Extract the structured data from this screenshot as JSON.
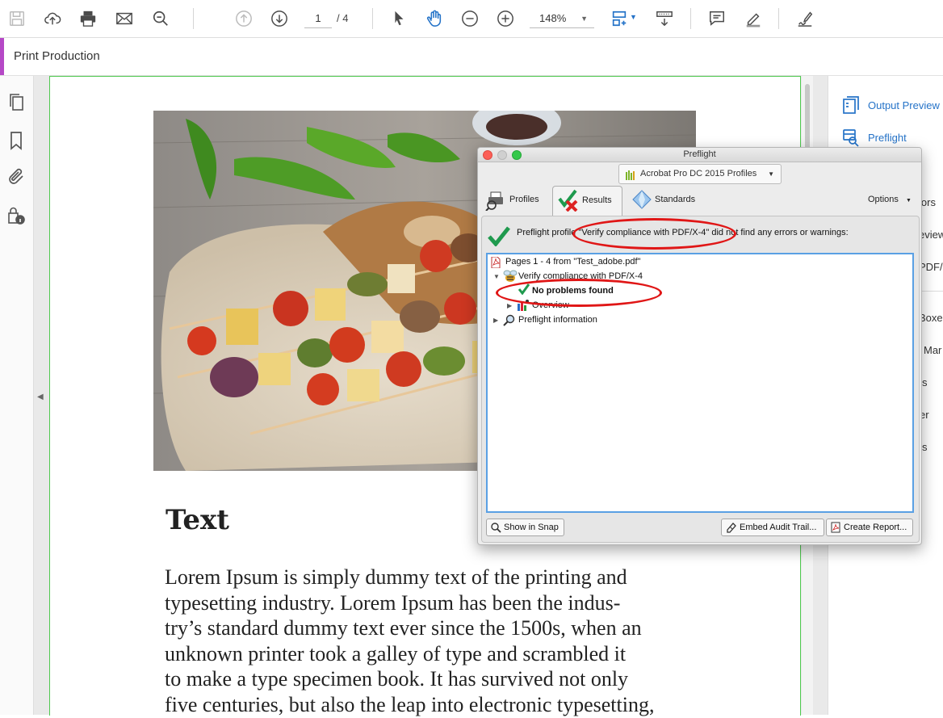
{
  "toolbar": {
    "page_current": "1",
    "page_total": "/ 4",
    "zoom": "148%",
    "icons": [
      "save-icon",
      "upload-icon",
      "print-icon",
      "email-icon",
      "search-icon",
      "page-up-icon",
      "page-down-icon",
      "select-cursor-icon",
      "hand-icon",
      "zoom-out-icon",
      "zoom-in-icon",
      "fit-page-icon",
      "scroll-mode-icon",
      "comment-icon",
      "highlight-icon",
      "sign-icon"
    ]
  },
  "tool_header": {
    "title": "Print Production",
    "accent_color": "#b548c6"
  },
  "left_nav": {
    "icons": [
      "pages-icon",
      "bookmark-icon",
      "attachment-icon",
      "security-icon"
    ]
  },
  "document": {
    "heading": "Text",
    "body_lines": [
      "Lorem Ipsum is simply dummy text of the printing and",
      "typesetting industry. Lorem Ipsum has been the indus-",
      "try’s standard dummy text ever since the 1500s, when an",
      "unknown printer took a galley of type and scrambled it",
      "to make a type specimen book. It has survived not only",
      "five centuries, but also the leap into electronic typesetting,"
    ]
  },
  "right_panel": {
    "links": [
      "Output Preview",
      "Preflight"
    ],
    "clipped_items": [
      "lors",
      "eview",
      "PDF/X",
      "Boxes",
      "Mar",
      "s",
      "er",
      "s"
    ]
  },
  "preflight": {
    "title": "Preflight",
    "profile_selector": "Acrobat Pro DC 2015 Profiles",
    "tabs": [
      "Profiles",
      "Results",
      "Standards"
    ],
    "active_tab": "Results",
    "options_label": "Options",
    "message": "Preflight profile \"Verify compliance with PDF/X-4\" did not find any errors or warnings:",
    "tree": {
      "root": "Pages 1 - 4 from \"Test_adobe.pdf\"",
      "profile": "Verify compliance with PDF/X-4",
      "result": "No problems found",
      "overview": "Overview",
      "info": "Preflight information"
    },
    "buttons": [
      "Show in Snap",
      "Embed Audit Trail...",
      "Create Report..."
    ],
    "highlight_color": "#e01616"
  }
}
